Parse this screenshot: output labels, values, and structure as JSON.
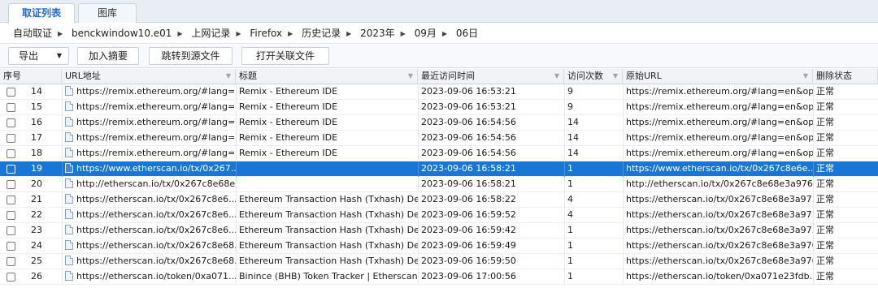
{
  "tabs": [
    {
      "label": "取证列表",
      "active": true
    },
    {
      "label": "图库",
      "active": false
    }
  ],
  "breadcrumb": [
    "自动取证",
    "benckwindow10.e01",
    "上网记录",
    "Firefox",
    "历史记录",
    "2023年",
    "09月",
    "06日"
  ],
  "toolbar": {
    "export_label": "导出",
    "add_summary_label": "加入摘要",
    "jump_source_label": "跳转到源文件",
    "open_related_label": "打开关联文件"
  },
  "table": {
    "columns": [
      "序号",
      "URL地址",
      "标题",
      "最近访问时间",
      "访问次数",
      "原始URL",
      "删除状态"
    ],
    "selected_index": 5,
    "rows": [
      {
        "id": "14",
        "url": "https://remix.ethereum.org/#lang=...",
        "title": "Remix - Ethereum IDE",
        "time": "2023-09-06 16:53:21",
        "count": "9",
        "orig": "https://remix.ethereum.org/#lang=en&opt...",
        "status": "正常"
      },
      {
        "id": "15",
        "url": "https://remix.ethereum.org/#lang=...",
        "title": "Remix - Ethereum IDE",
        "time": "2023-09-06 16:53:21",
        "count": "9",
        "orig": "https://remix.ethereum.org/#lang=en&opt...",
        "status": "正常"
      },
      {
        "id": "16",
        "url": "https://remix.ethereum.org/#lang=...",
        "title": "Remix - Ethereum IDE",
        "time": "2023-09-06 16:54:56",
        "count": "14",
        "orig": "https://remix.ethereum.org/#lang=en&opt...",
        "status": "正常"
      },
      {
        "id": "17",
        "url": "https://remix.ethereum.org/#lang=...",
        "title": "Remix - Ethereum IDE",
        "time": "2023-09-06 16:54:56",
        "count": "14",
        "orig": "https://remix.ethereum.org/#lang=en&opt...",
        "status": "正常"
      },
      {
        "id": "18",
        "url": "https://remix.ethereum.org/#lang=...",
        "title": "Remix - Ethereum IDE",
        "time": "2023-09-06 16:54:56",
        "count": "14",
        "orig": "https://remix.ethereum.org/#lang=en&opt...",
        "status": "正常"
      },
      {
        "id": "19",
        "url": "https://www.etherscan.io/tx/0x267...",
        "title": "",
        "time": "2023-09-06 16:58:21",
        "count": "1",
        "orig": "https://www.etherscan.io/tx/0x267c8e6e...",
        "status": "正常"
      },
      {
        "id": "20",
        "url": "http://etherscan.io/tx/0x267c8e68e...",
        "title": "",
        "time": "2023-09-06 16:58:21",
        "count": "1",
        "orig": "http://etherscan.io/tx/0x267c8e68e3a9769...",
        "status": "正常"
      },
      {
        "id": "21",
        "url": "https://etherscan.io/tx/0x267c8e6...",
        "title": "Ethereum Transaction Hash (Txhash) De...",
        "time": "2023-09-06 16:58:22",
        "count": "4",
        "orig": "https://etherscan.io/tx/0x267c8e68e3a97...",
        "status": "正常"
      },
      {
        "id": "22",
        "url": "https://etherscan.io/tx/0x267c8e6...",
        "title": "Ethereum Transaction Hash (Txhash) De...",
        "time": "2023-09-06 16:59:52",
        "count": "4",
        "orig": "https://etherscan.io/tx/0x267c8e68e3a97...",
        "status": "正常"
      },
      {
        "id": "23",
        "url": "https://etherscan.io/tx/0x267c8e6...",
        "title": "Ethereum Transaction Hash (Txhash) De...",
        "time": "2023-09-06 16:59:42",
        "count": "1",
        "orig": "https://etherscan.io/tx/0x267c8e68e3a97...",
        "status": "正常"
      },
      {
        "id": "24",
        "url": "https://etherscan.io/tx/0x267c8e68...",
        "title": "Ethereum Transaction Hash (Txhash) De...",
        "time": "2023-09-06 16:59:49",
        "count": "1",
        "orig": "https://etherscan.io/tx/0x267c8e68e3a976...",
        "status": "正常"
      },
      {
        "id": "25",
        "url": "https://etherscan.io/tx/0x267c8e68...",
        "title": "Ethereum Transaction Hash (Txhash) De...",
        "time": "2023-09-06 16:59:50",
        "count": "1",
        "orig": "https://etherscan.io/tx/0x267c8e68e3a976...",
        "status": "正常"
      },
      {
        "id": "26",
        "url": "https://etherscan.io/token/0xa071...",
        "title": "Binince (BHB) Token Tracker | Etherscan",
        "time": "2023-09-06 17:00:56",
        "count": "1",
        "orig": "https://etherscan.io/token/0xa071e23fdb...",
        "status": "正常"
      }
    ]
  },
  "icons": {
    "filter": "filter-funnel-icon",
    "dropdown": "chevron-down-icon",
    "file": "document-icon",
    "separator": "triangle-right-icon"
  },
  "colors": {
    "accent": "#1f6bd6",
    "selected_row": "#1877d6"
  }
}
